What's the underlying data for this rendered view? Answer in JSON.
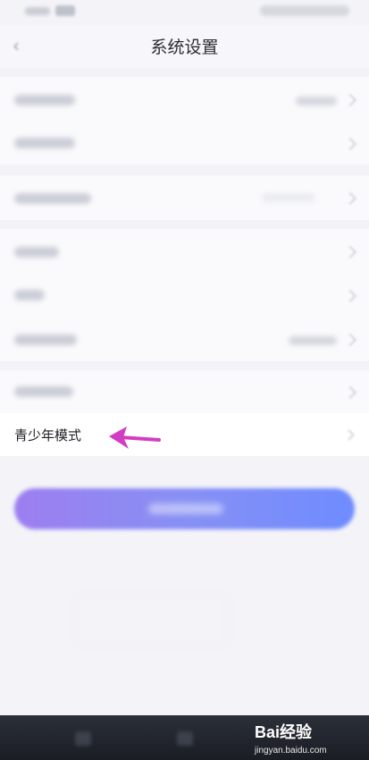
{
  "nav": {
    "title": "系统设置"
  },
  "settings": {
    "teen_mode_label": "青少年模式"
  },
  "watermark": {
    "brand": "Bai经验",
    "domain": "jingyan.baidu.com"
  },
  "colors": {
    "arrow": "#d23dc3",
    "button_start": "#9c7ef0",
    "button_end": "#6f8cff",
    "bottom_bar": "#1f2229"
  }
}
